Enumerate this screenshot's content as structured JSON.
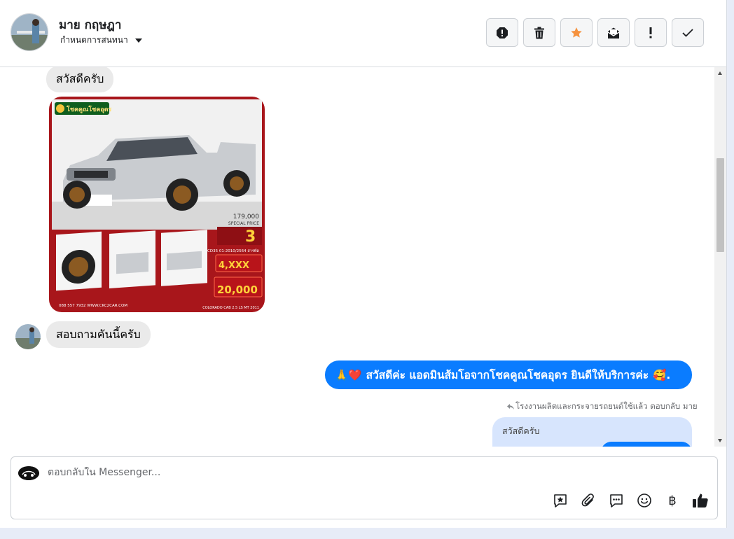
{
  "header": {
    "customer_name": "มาย กฤษฎา",
    "assign_label": "กำหนดการสนทนา",
    "toolbar": [
      {
        "name": "spam-icon",
        "label": "!"
      },
      {
        "name": "trash-icon"
      },
      {
        "name": "star-icon",
        "color": "#f5923e"
      },
      {
        "name": "mark-unread-icon"
      },
      {
        "name": "follow-up-icon",
        "label": "!"
      },
      {
        "name": "done-icon"
      }
    ]
  },
  "messages": {
    "greeting": "สวัสดีครับ",
    "inquiry": "สอบถามคันนี้ครับ",
    "reply_text": "สวัสดีค่ะ แอดมินส้มโอจากโชคคูณโชคอุดร ยินดีให้บริการค่ะ",
    "reply_emoji_lead": "🙏❤️",
    "reply_emoji_trail": "🥰.",
    "reply_note": "โรงงานผลิตและกระจายรถยนต์ใช้แล้ว ตอบกลับ มาย",
    "quoted_text": "สวัสดีครับ"
  },
  "ad_image": {
    "badge": "โชคคูณโชคอุดร",
    "price_value": "179,000",
    "price_label": "SPECIAL PRICE",
    "installment_years": "3",
    "model_line": "CD35 01-2010/2564 สารพัด",
    "down_payment": "4,XXX",
    "monthly": "20,000",
    "footer_phone": "088 557 7932 WWW.CKC2CAR.COM",
    "footer_model": "COLORADO CAB 2.5 LS MT 2011"
  },
  "composer": {
    "placeholder": "ตอบกลับใน Messenger...",
    "tools": [
      "saved-reply-icon",
      "attach-icon",
      "quick-reply-icon",
      "emoji-icon",
      "baht-icon",
      "like-icon"
    ],
    "baht_symbol": "฿"
  },
  "colors": {
    "outgoing_bubble": "#0a7cff",
    "incoming_bubble": "#eaeaea",
    "quoted_bubble": "#d7e5fd",
    "star": "#f5923e"
  }
}
